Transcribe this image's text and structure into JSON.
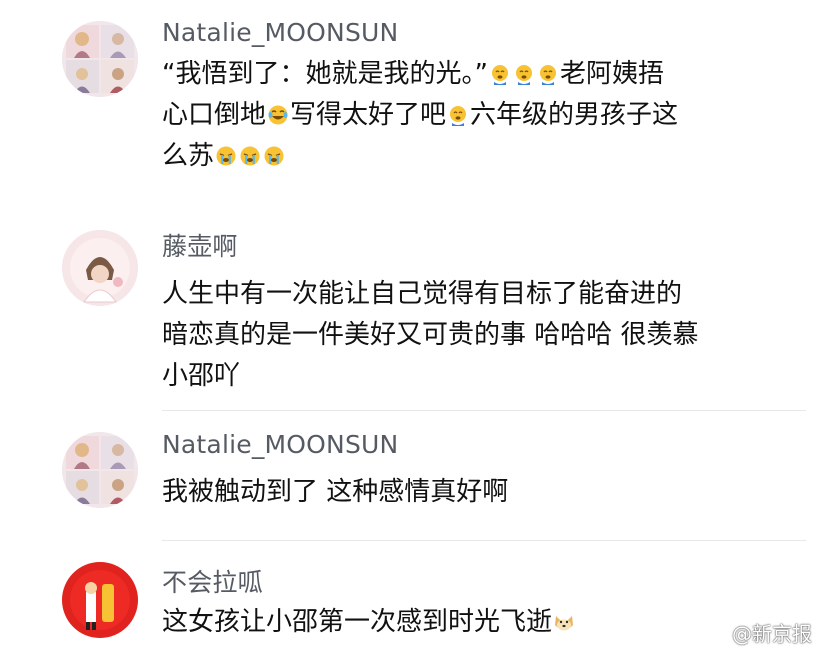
{
  "comments": [
    {
      "username": "Natalie_MOONSUN",
      "avatar": "photo-collage-avatar",
      "text_parts": [
        "“我悟到了：她就是我的光。”",
        "老阿姨捂",
        "心口倒地",
        "写得太好了吧",
        "六年级的男孩子这",
        "么苏"
      ]
    },
    {
      "username": "藤壶啊",
      "avatar": "illustrated-girl-avatar",
      "text_lines": [
        "人生中有一次能让自己觉得有目标了能奋进的",
        "暗恋真的是一件美好又可贵的事 哈哈哈 很羡慕",
        "小邵吖"
      ]
    },
    {
      "username": "Natalie_MOONSUN",
      "avatar": "photo-collage-avatar",
      "text": "我被触动到了 这种感情真好啊"
    },
    {
      "username": "不会拉呱",
      "avatar": "cartoon-red-avatar",
      "text": "这女孩让小邵第一次感到时光飞逝"
    }
  ],
  "watermark": {
    "text": "@新京报",
    "icon": "weibo-logo-icon"
  },
  "colors": {
    "username": "#555a63",
    "text": "#111111",
    "divider": "#e8e8e8"
  }
}
